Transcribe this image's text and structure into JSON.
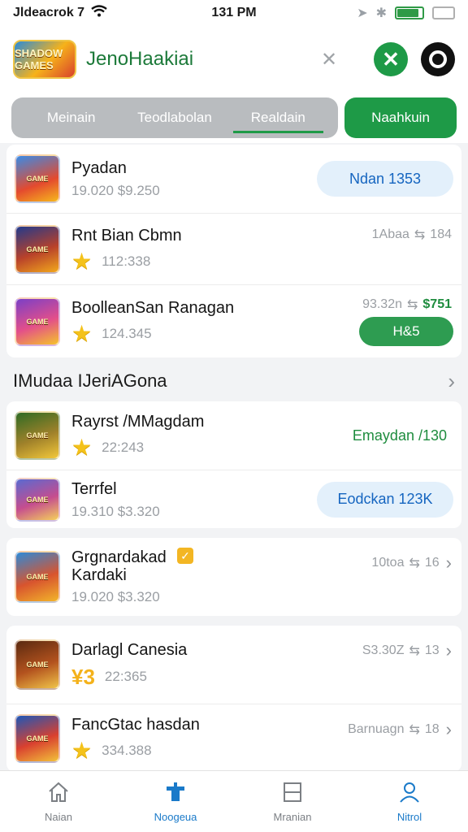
{
  "status_bar": {
    "carrier": "Jldeacrok 7",
    "time": "131 PM"
  },
  "header": {
    "title": "JenoHaakiai",
    "logo_text": "SHADOW\nGAMES"
  },
  "tabs": [
    {
      "label": "Meinain"
    },
    {
      "label": "Teodlabolan"
    },
    {
      "label": "Realdain"
    }
  ],
  "tab_cta": "Naahkuin",
  "list1": [
    {
      "name": "Pyadan",
      "sub": "19.020 $9.250",
      "action": "Ndan 1353",
      "action_type": "blue"
    },
    {
      "name": "Rnt Bian Cbmn",
      "sub": "112:338",
      "meta": "1Abaa",
      "meta_num": "184",
      "has_star": true
    },
    {
      "name": "BoolleanSan Ranagan",
      "sub": "124.345",
      "meta": "93.32n",
      "meta_price": "$751",
      "action": "H&5",
      "action_type": "green",
      "has_star": true
    }
  ],
  "section": {
    "title": "IMudaa IJeriAGona"
  },
  "list2": [
    {
      "name": "Rayrst /MMagdam",
      "sub": "22:243",
      "action": "Emaydan /130",
      "action_type": "green-text",
      "has_star": true
    },
    {
      "name": "Terrfel",
      "sub": "19.310 $3.320",
      "action": "Eodckan 123K",
      "action_type": "blue"
    }
  ],
  "list3": [
    {
      "name": "Grgnardakad\nKardaki",
      "sub": "19.020 $3.320",
      "meta": "10toa",
      "meta_num": "16",
      "verified": "✓"
    }
  ],
  "list4": [
    {
      "name": "Darlagl Canesia",
      "sub": "22:365",
      "meta": "S3.30Z",
      "meta_num": "13",
      "coin": "¥3"
    },
    {
      "name": "FancGtac hasdan",
      "sub": "334.388",
      "meta": "Barnuagn",
      "meta_num": "18",
      "has_star": true
    }
  ],
  "bottom_nav": [
    {
      "label": "Naian",
      "icon": "home-icon"
    },
    {
      "label": "Noogeua",
      "icon": "games-icon",
      "active": true
    },
    {
      "label": "Mranian",
      "icon": "menu-icon"
    },
    {
      "label": "Nitrol",
      "icon": "user-icon"
    }
  ],
  "colors": {
    "brand_green": "#1e9a47",
    "link_blue": "#1565c0",
    "star": "#f4c21b"
  }
}
